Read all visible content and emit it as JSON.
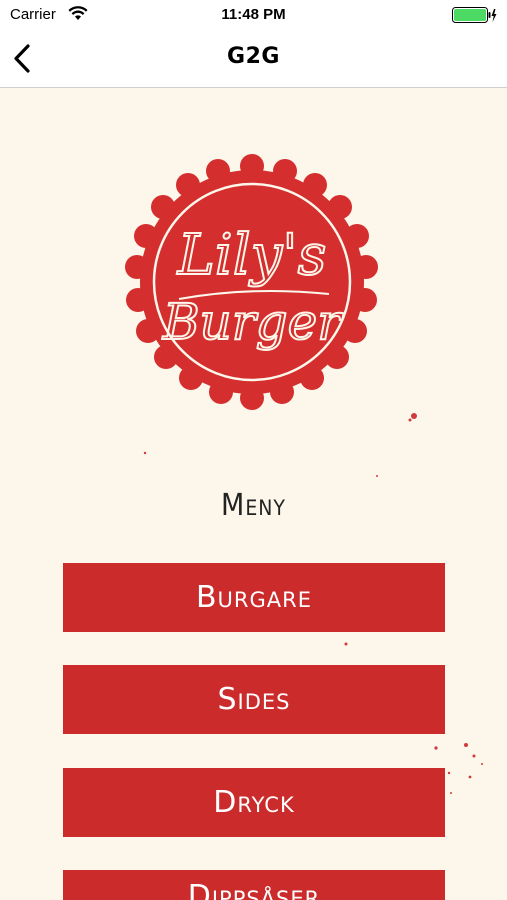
{
  "status_bar": {
    "carrier": "Carrier",
    "time": "11:48 PM"
  },
  "nav": {
    "title": "G2G"
  },
  "logo": {
    "line1": "Lily's",
    "line2": "Burger",
    "color": "#d42e2e"
  },
  "menu": {
    "title": "Meny",
    "items": [
      {
        "label": "Burgare"
      },
      {
        "label": "Sides"
      },
      {
        "label": "Dryck"
      },
      {
        "label": "Dippsåser"
      }
    ]
  },
  "colors": {
    "background": "#fcf7ea",
    "accent": "#cc2b2b",
    "battery": "#4cd964"
  }
}
